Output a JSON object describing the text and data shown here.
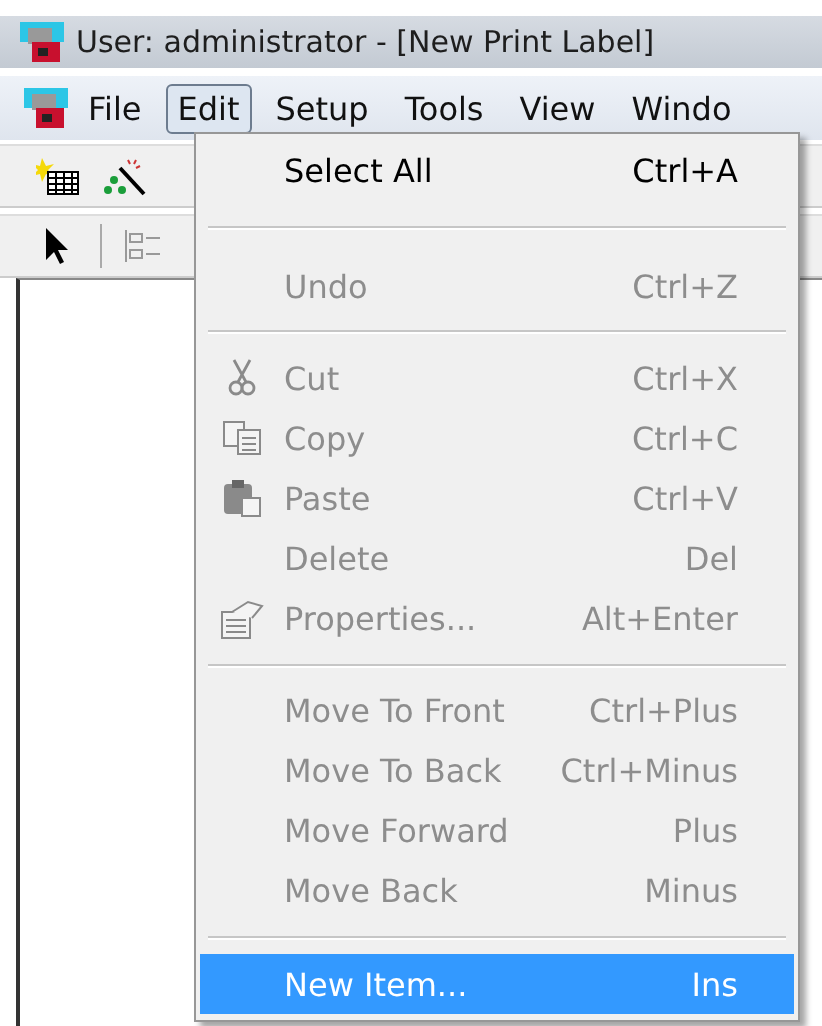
{
  "window": {
    "title": "User: administrator - [New Print Label]"
  },
  "menu_bar": [
    {
      "label": "File",
      "selected": false
    },
    {
      "label": "Edit",
      "selected": true
    },
    {
      "label": "Setup",
      "selected": false
    },
    {
      "label": "Tools",
      "selected": false
    },
    {
      "label": "View",
      "selected": false
    },
    {
      "label": "Windo",
      "selected": false
    }
  ],
  "edit_menu": [
    {
      "kind": "plain",
      "label": "Select All",
      "shortcut": "Ctrl+A",
      "disabled": false,
      "selected": false
    },
    {
      "kind": "separator"
    },
    {
      "kind": "plain",
      "label": "Undo",
      "shortcut": "Ctrl+Z",
      "disabled": true,
      "selected": false
    },
    {
      "kind": "separator"
    },
    {
      "kind": "cut",
      "label": "Cut",
      "shortcut": "Ctrl+X",
      "disabled": true,
      "selected": false
    },
    {
      "kind": "copy",
      "label": "Copy",
      "shortcut": "Ctrl+C",
      "disabled": true,
      "selected": false
    },
    {
      "kind": "paste",
      "label": "Paste",
      "shortcut": "Ctrl+V",
      "disabled": true,
      "selected": false
    },
    {
      "kind": "plain",
      "label": "Delete",
      "shortcut": "Del",
      "disabled": true,
      "selected": false
    },
    {
      "kind": "properties",
      "label": "Properties...",
      "shortcut": "Alt+Enter",
      "disabled": true,
      "selected": false
    },
    {
      "kind": "separator"
    },
    {
      "kind": "plain",
      "label": "Move To Front",
      "shortcut": "Ctrl+Plus",
      "disabled": true,
      "selected": false
    },
    {
      "kind": "plain",
      "label": "Move To Back",
      "shortcut": "Ctrl+Minus",
      "disabled": true,
      "selected": false
    },
    {
      "kind": "plain",
      "label": "Move Forward",
      "shortcut": "Plus",
      "disabled": true,
      "selected": false
    },
    {
      "kind": "plain",
      "label": "Move Back",
      "shortcut": "Minus",
      "disabled": true,
      "selected": false
    },
    {
      "kind": "separator"
    },
    {
      "kind": "plain",
      "label": "New Item...",
      "shortcut": "Ins",
      "disabled": false,
      "selected": true
    }
  ]
}
